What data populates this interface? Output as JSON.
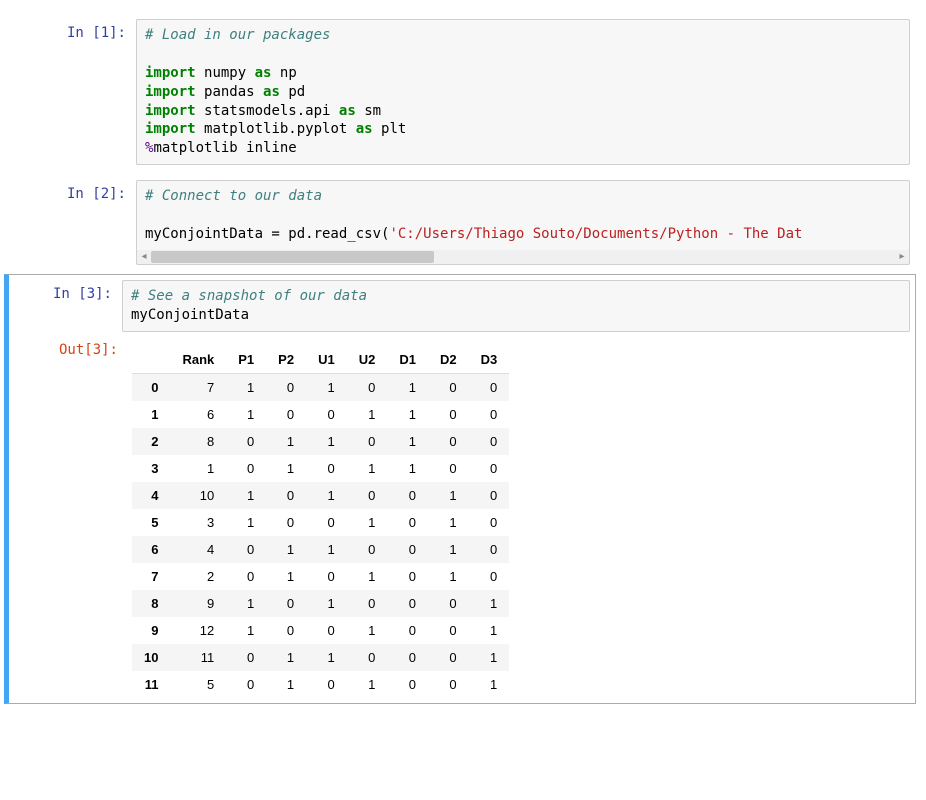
{
  "cells": [
    {
      "in_label": "In [1]:",
      "code": {
        "l1_comment": "# Load in our packages",
        "l2_kw1": "import",
        "l2_mod": "numpy",
        "l2_kw2": "as",
        "l2_alias": "np",
        "l3_kw1": "import",
        "l3_mod": "pandas",
        "l3_kw2": "as",
        "l3_alias": "pd",
        "l4_kw1": "import",
        "l4_mod": "statsmodels.api",
        "l4_kw2": "as",
        "l4_alias": "sm",
        "l5_kw1": "import",
        "l5_mod": "matplotlib.pyplot",
        "l5_kw2": "as",
        "l5_alias": "plt",
        "l6_pct": "%",
        "l6_rest": "matplotlib inline"
      }
    },
    {
      "in_label": "In [2]:",
      "code": {
        "l1_comment": "# Connect to our data",
        "l2_lhs": "myConjointData = pd.read_csv(",
        "l2_str": "'C:/Users/Thiago Souto/Documents/Python - The Dat"
      }
    },
    {
      "in_label": "In [3]:",
      "out_label": "Out[3]:",
      "code": {
        "l1_comment": "# See a snapshot of our data",
        "l2": "myConjointData"
      },
      "table": {
        "columns": [
          "",
          "Rank",
          "P1",
          "P2",
          "U1",
          "U2",
          "D1",
          "D2",
          "D3"
        ],
        "rows": [
          [
            "0",
            "7",
            "1",
            "0",
            "1",
            "0",
            "1",
            "0",
            "0"
          ],
          [
            "1",
            "6",
            "1",
            "0",
            "0",
            "1",
            "1",
            "0",
            "0"
          ],
          [
            "2",
            "8",
            "0",
            "1",
            "1",
            "0",
            "1",
            "0",
            "0"
          ],
          [
            "3",
            "1",
            "0",
            "1",
            "0",
            "1",
            "1",
            "0",
            "0"
          ],
          [
            "4",
            "10",
            "1",
            "0",
            "1",
            "0",
            "0",
            "1",
            "0"
          ],
          [
            "5",
            "3",
            "1",
            "0",
            "0",
            "1",
            "0",
            "1",
            "0"
          ],
          [
            "6",
            "4",
            "0",
            "1",
            "1",
            "0",
            "0",
            "1",
            "0"
          ],
          [
            "7",
            "2",
            "0",
            "1",
            "0",
            "1",
            "0",
            "1",
            "0"
          ],
          [
            "8",
            "9",
            "1",
            "0",
            "1",
            "0",
            "0",
            "0",
            "1"
          ],
          [
            "9",
            "12",
            "1",
            "0",
            "0",
            "1",
            "0",
            "0",
            "1"
          ],
          [
            "10",
            "11",
            "0",
            "1",
            "1",
            "0",
            "0",
            "0",
            "1"
          ],
          [
            "11",
            "5",
            "0",
            "1",
            "0",
            "1",
            "0",
            "0",
            "1"
          ]
        ]
      }
    }
  ]
}
